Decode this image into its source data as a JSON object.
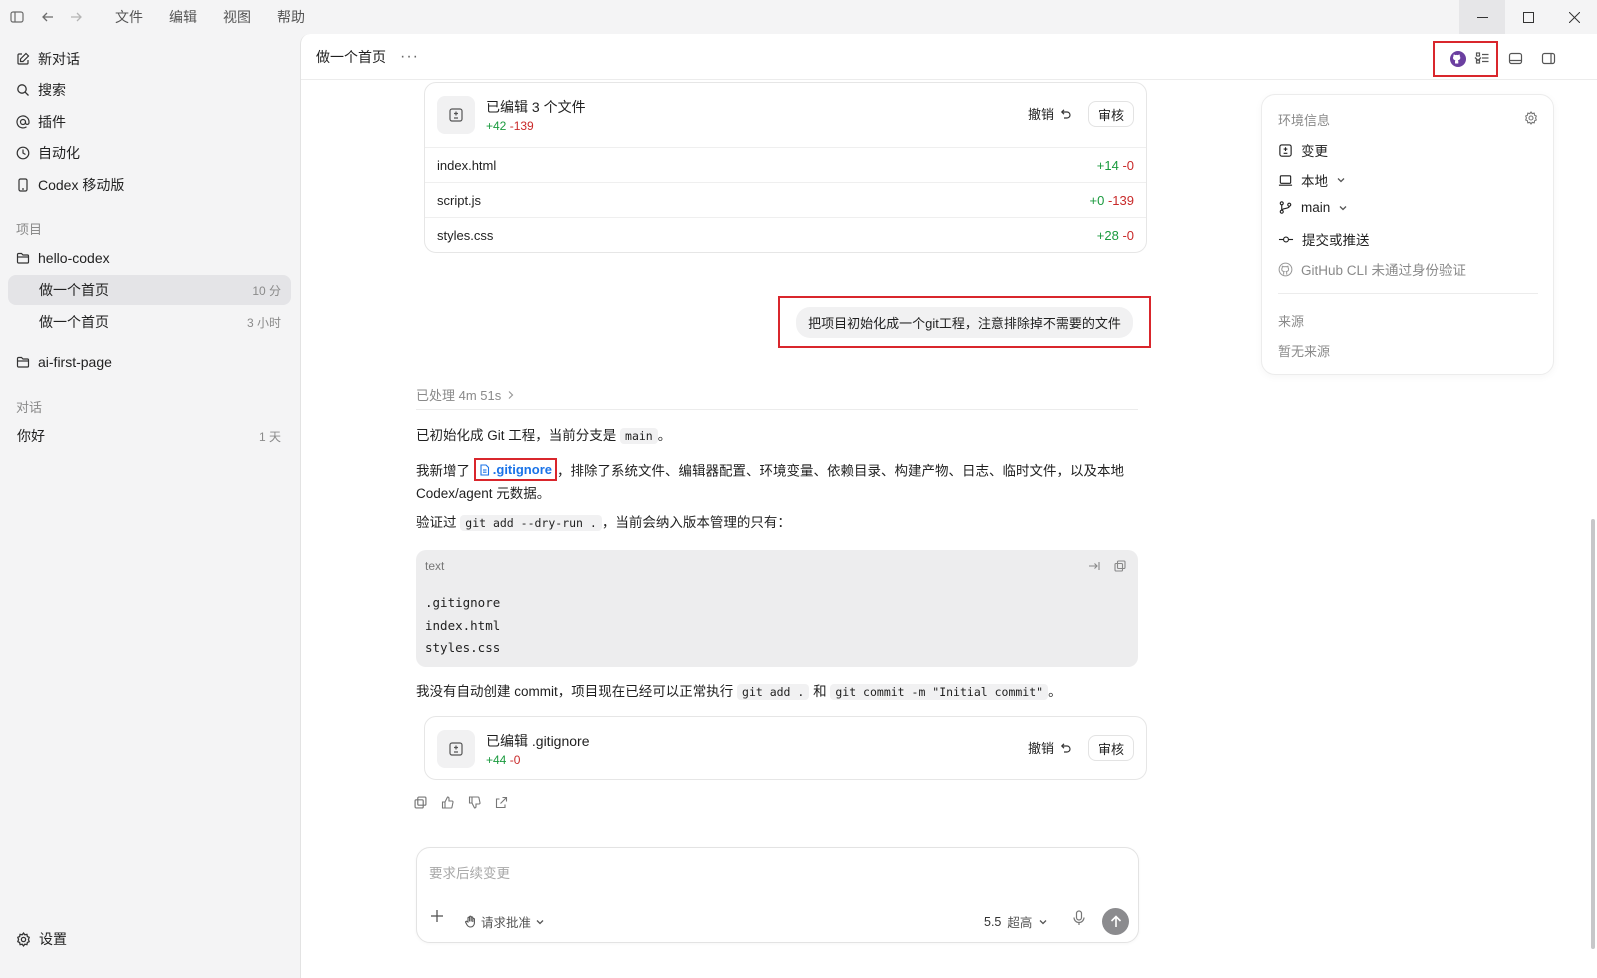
{
  "menu": [
    "文件",
    "编辑",
    "视图",
    "帮助"
  ],
  "sidebar": {
    "nav": [
      {
        "label": "新对话",
        "icon": "edit-icon"
      },
      {
        "label": "搜索",
        "icon": "search-icon"
      },
      {
        "label": "插件",
        "icon": "at-icon"
      },
      {
        "label": "自动化",
        "icon": "clock-icon"
      },
      {
        "label": "Codex 移动版",
        "icon": "phone-icon"
      }
    ],
    "projects_label": "项目",
    "projects": [
      {
        "name": "hello-codex",
        "threads": [
          {
            "title": "做一个首页",
            "time": "10 分"
          },
          {
            "title": "做一个首页",
            "time": "3 小时"
          }
        ]
      },
      {
        "name": "ai-first-page",
        "threads": []
      }
    ],
    "conversations_label": "对话",
    "conversations": [
      {
        "title": "你好",
        "time": "1 天"
      }
    ],
    "settings_label": "设置"
  },
  "header": {
    "title": "做一个首页",
    "more": "···"
  },
  "edit_card_1": {
    "title": "已编辑 3 个文件",
    "plus": "+42",
    "minus": "-139",
    "undo_label": "撤销",
    "review_label": "审核",
    "files": [
      {
        "name": "index.html",
        "plus": "+14",
        "minus": "-0"
      },
      {
        "name": "script.js",
        "plus": "+0",
        "minus": "-139"
      },
      {
        "name": "styles.css",
        "plus": "+28",
        "minus": "-0"
      }
    ]
  },
  "user_message": "把项目初始化成一个git工程，注意排除掉不需要的文件",
  "processed": "已处理 4m 51s",
  "reply": {
    "p1_text": "已初始化成 Git 工程，当前分支是",
    "p1_code": "main",
    "p1_end": "。",
    "p2_pre": "我新增了",
    "p2_link": ".gitignore",
    "p2_post": "，排除了系统文件、编辑器配置、环境变量、依赖目录、构建产物、日志、临时文件，以及本地 Codex/agent 元数据。",
    "p3_pre": "验证过",
    "p3_code": "git add --dry-run .",
    "p3_post": "，当前会纳入版本管理的只有：",
    "code_lang": "text",
    "code_lines": [
      ".gitignore",
      "index.html",
      "styles.css"
    ],
    "p4_pre": "我没有自动创建 commit，项目现在已经可以正常执行",
    "p4_code1": "git add .",
    "p4_mid": "和",
    "p4_code2": "git commit -m \"Initial commit\"",
    "p4_end": "。"
  },
  "edit_card_2": {
    "title": "已编辑 .gitignore",
    "plus": "+44",
    "minus": "-0",
    "undo_label": "撤销",
    "review_label": "审核"
  },
  "composer": {
    "placeholder": "要求后续变更",
    "approval_label": "请求批准",
    "model_label": "5.5",
    "effort_label": "超高"
  },
  "env_panel": {
    "title": "环境信息",
    "rows": [
      {
        "label": "变更",
        "icon": "diff-icon"
      },
      {
        "label": "本地",
        "icon": "laptop-icon"
      },
      {
        "label": "main",
        "icon": "branch-icon"
      },
      {
        "label": "提交或推送",
        "icon": "commit-icon"
      },
      {
        "label": "GitHub CLI 未通过身份验证",
        "icon": "github-icon"
      }
    ],
    "source_label": "来源",
    "no_source": "暂无来源"
  },
  "colors": {
    "added": "#1a9a3e",
    "removed": "#c92a2a",
    "highlight_border": "#d9262c",
    "link": "#1a73e8"
  }
}
